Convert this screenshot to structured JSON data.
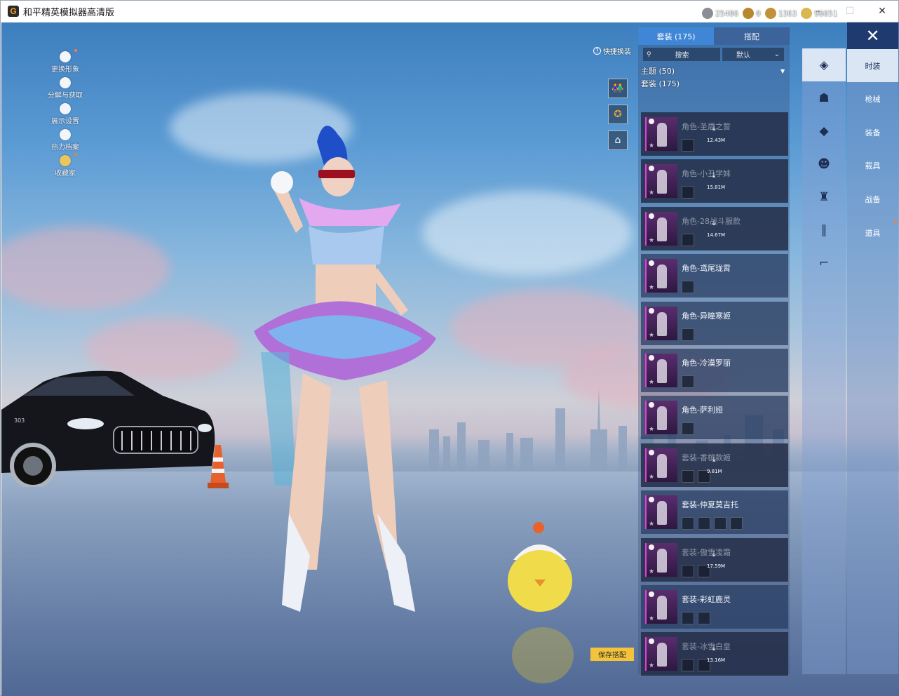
{
  "window": {
    "title": "和平精英模拟器高清版",
    "app_icon_glyph": "G",
    "minimize_icon": "–",
    "maximize_icon": "☐",
    "close_icon": "✕"
  },
  "left_menu": [
    {
      "label": "更换形象",
      "icon": "avatar-icon",
      "dot": true
    },
    {
      "label": "分解与获取",
      "icon": "puzzle-icon",
      "dot": false
    },
    {
      "label": "展示设置",
      "icon": "eye-icon",
      "dot": false
    },
    {
      "label": "热力档案",
      "icon": "flame-icon",
      "dot": false
    },
    {
      "label": "收藏家",
      "icon": "collector-badge-icon",
      "dot": true
    }
  ],
  "currency": [
    {
      "icon": "gear-currency-icon",
      "value": "25406",
      "color": "#8a8f96"
    },
    {
      "icon": "coin-currency-icon",
      "value": "0",
      "color": "#b7892e"
    },
    {
      "icon": "medal-currency-icon",
      "value": "1363",
      "color": "#c2923a"
    },
    {
      "icon": "gold-currency-icon",
      "value": "96651",
      "color": "#d9b852"
    }
  ],
  "quick_change": {
    "label": "快捷换装",
    "icon": "question-icon",
    "buttons": [
      {
        "name": "outfit-pair-icon",
        "glyph": "👫"
      },
      {
        "name": "emblem-icon",
        "glyph": "✪"
      },
      {
        "name": "wardrobe-icon",
        "glyph": "⌂"
      }
    ]
  },
  "tabs": [
    {
      "label": "套装 (175)",
      "active": true
    },
    {
      "label": "搭配",
      "active": false
    }
  ],
  "search": {
    "icon": "search-icon",
    "label": "搜索"
  },
  "sort": {
    "label": "默认",
    "arrow": "⌄"
  },
  "filters": {
    "theme": "主题 (50)",
    "theme_arrow": "▼",
    "suit": "套装 (175)"
  },
  "items": [
    {
      "name": "角色-圣盾之誓",
      "downloadable": true,
      "size": "12.43M",
      "subs": 1
    },
    {
      "name": "角色-小丑学妹",
      "downloadable": true,
      "size": "15.81M",
      "subs": 1
    },
    {
      "name": "角色-28战斗服款",
      "downloadable": true,
      "size": "14.67M",
      "subs": 1
    },
    {
      "name": "角色-鸢尾珑霄",
      "downloadable": false,
      "size": "",
      "subs": 1
    },
    {
      "name": "角色-异瞳寒姬",
      "downloadable": false,
      "size": "",
      "subs": 1
    },
    {
      "name": "角色-冷漠罗丽",
      "downloadable": false,
      "size": "",
      "subs": 1
    },
    {
      "name": "角色-萨利娅",
      "downloadable": false,
      "size": "",
      "subs": 1
    },
    {
      "name": "套装-香槟款姬",
      "downloadable": true,
      "size": "9.81M",
      "subs": 2
    },
    {
      "name": "套装-仲夏莫吉托",
      "downloadable": false,
      "size": "",
      "subs": 4
    },
    {
      "name": "套装-傲雪凌霜",
      "downloadable": true,
      "size": "17.59M",
      "subs": 2
    },
    {
      "name": "套装-彩虹鹿灵",
      "downloadable": false,
      "size": "",
      "subs": 2
    },
    {
      "name": "套装-冰雪白皇",
      "downloadable": true,
      "size": "13.16M",
      "subs": 2
    }
  ],
  "icon_column": [
    {
      "name": "outfit-hat-icon",
      "glyph": "◈",
      "active": true
    },
    {
      "name": "character-icon",
      "glyph": "☗",
      "active": false
    },
    {
      "name": "backpack-icon",
      "glyph": "◆",
      "active": false
    },
    {
      "name": "mask-icon",
      "glyph": "☻",
      "active": false
    },
    {
      "name": "top-icon",
      "glyph": "♜",
      "active": false
    },
    {
      "name": "pants-icon",
      "glyph": "‖",
      "active": false
    },
    {
      "name": "shoes-icon",
      "glyph": "⌐",
      "active": false
    }
  ],
  "categories": [
    {
      "label": "时装",
      "active": true,
      "dot": false
    },
    {
      "label": "枪械",
      "active": false,
      "dot": false
    },
    {
      "label": "装备",
      "active": false,
      "dot": false
    },
    {
      "label": "载具",
      "active": false,
      "dot": false
    },
    {
      "label": "战备",
      "active": false,
      "dot": false
    },
    {
      "label": "道具",
      "active": false,
      "dot": true
    }
  ],
  "close_panel_icon": "✕",
  "save_button": "保存搭配",
  "car_plate": "303"
}
